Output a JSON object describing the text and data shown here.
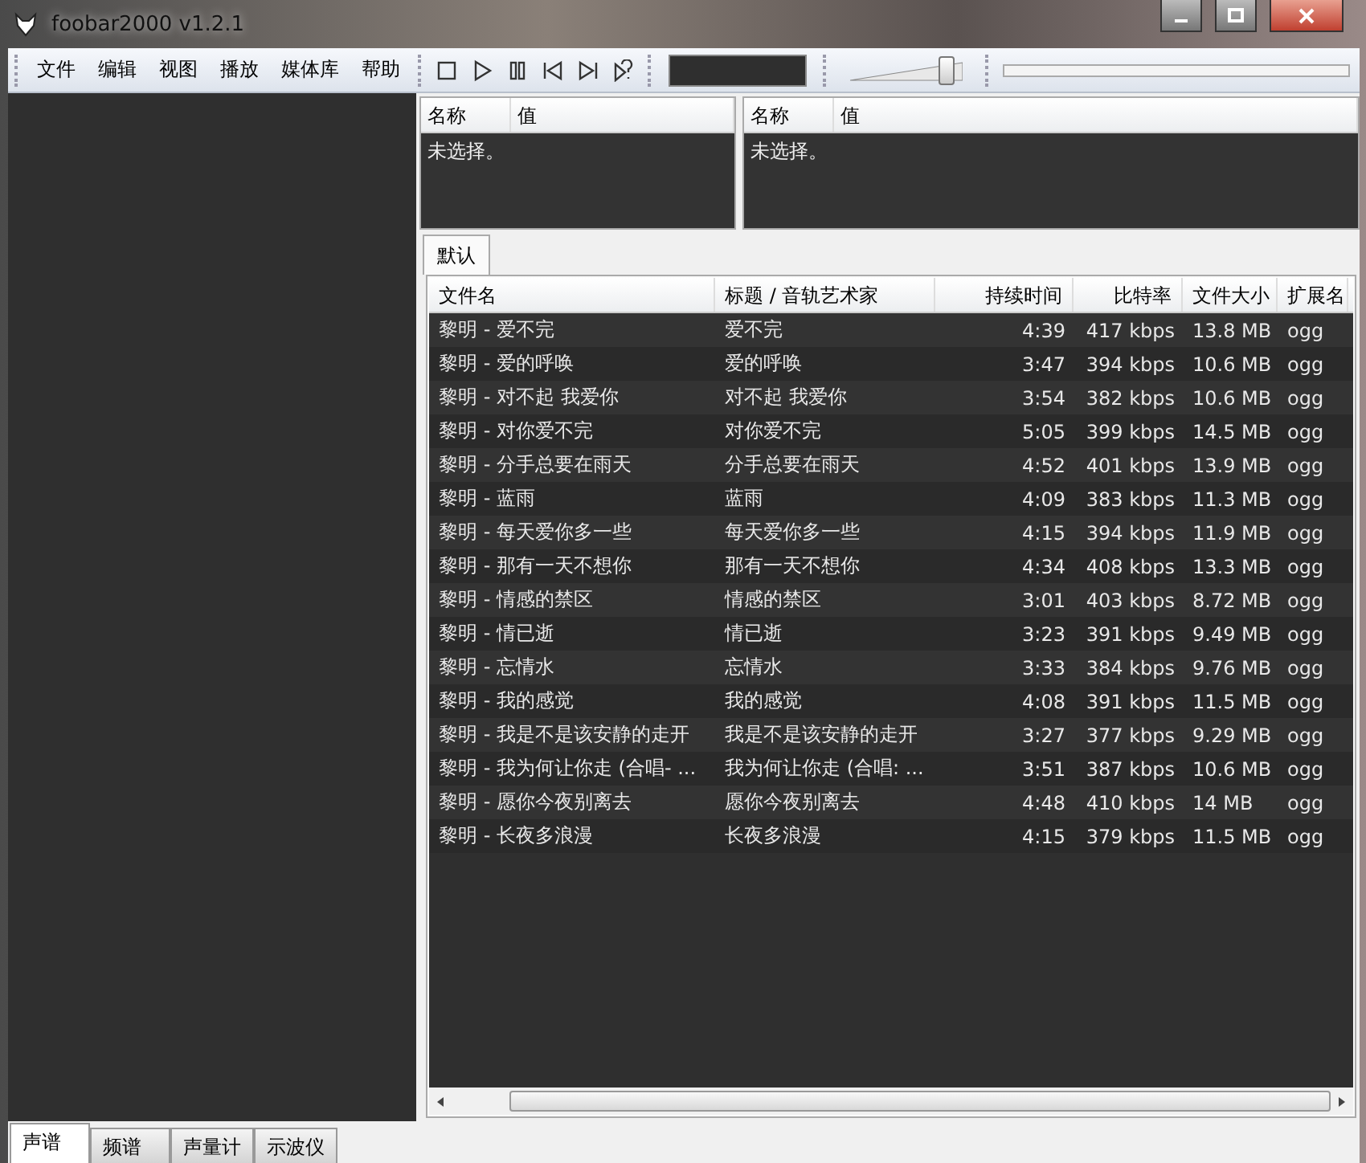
{
  "window": {
    "title": "foobar2000 v1.2.1"
  },
  "menu": [
    "文件",
    "编辑",
    "视图",
    "播放",
    "媒体库",
    "帮助"
  ],
  "volume": {
    "level": 0.86
  },
  "properties_panels": [
    {
      "columns": [
        "名称",
        "值"
      ],
      "message": "未选择。"
    },
    {
      "columns": [
        "名称",
        "值"
      ],
      "message": "未选择。"
    }
  ],
  "playlist_tabs": [
    {
      "label": "默认",
      "selected": true
    }
  ],
  "playlist": {
    "columns": [
      "文件名",
      "标题 / 音轨艺术家",
      "持续时间",
      "比特率",
      "文件大小",
      "扩展名"
    ],
    "rows": [
      [
        "黎明 - 爱不完",
        "爱不完",
        "4:39",
        "417 kbps",
        "13.8 MB",
        "ogg"
      ],
      [
        "黎明 - 爱的呼唤",
        "爱的呼唤",
        "3:47",
        "394 kbps",
        "10.6 MB",
        "ogg"
      ],
      [
        "黎明 - 对不起 我爱你",
        "对不起 我爱你",
        "3:54",
        "382 kbps",
        "10.6 MB",
        "ogg"
      ],
      [
        "黎明 - 对你爱不完",
        "对你爱不完",
        "5:05",
        "399 kbps",
        "14.5 MB",
        "ogg"
      ],
      [
        "黎明 - 分手总要在雨天",
        "分手总要在雨天",
        "4:52",
        "401 kbps",
        "13.9 MB",
        "ogg"
      ],
      [
        "黎明 - 蓝雨",
        "蓝雨",
        "4:09",
        "383 kbps",
        "11.3 MB",
        "ogg"
      ],
      [
        "黎明 - 每天爱你多一些",
        "每天爱你多一些",
        "4:15",
        "394 kbps",
        "11.9 MB",
        "ogg"
      ],
      [
        "黎明 - 那有一天不想你",
        "那有一天不想你",
        "4:34",
        "408 kbps",
        "13.3 MB",
        "ogg"
      ],
      [
        "黎明 - 情感的禁区",
        "情感的禁区",
        "3:01",
        "403 kbps",
        "8.72 MB",
        "ogg"
      ],
      [
        "黎明 - 情已逝",
        "情已逝",
        "3:23",
        "391 kbps",
        "9.49 MB",
        "ogg"
      ],
      [
        "黎明 - 忘情水",
        "忘情水",
        "3:33",
        "384 kbps",
        "9.76 MB",
        "ogg"
      ],
      [
        "黎明 - 我的感觉",
        "我的感觉",
        "4:08",
        "391 kbps",
        "11.5 MB",
        "ogg"
      ],
      [
        "黎明 - 我是不是该安静的走开",
        "我是不是该安静的走开",
        "3:27",
        "377 kbps",
        "9.29 MB",
        "ogg"
      ],
      [
        "黎明 - 我为何让你走 (合唱- ...",
        "我为何让你走 (合唱: ...",
        "3:51",
        "387 kbps",
        "10.6 MB",
        "ogg"
      ],
      [
        "黎明 - 愿你今夜别离去",
        "愿你今夜别离去",
        "4:48",
        "410 kbps",
        "14 MB",
        "ogg"
      ],
      [
        "黎明 - 长夜多浪漫",
        "长夜多浪漫",
        "4:15",
        "379 kbps",
        "11.5 MB",
        "ogg"
      ]
    ]
  },
  "visual_tabs": [
    {
      "label": "声谱",
      "selected": true
    },
    {
      "label": "频谱",
      "selected": false
    },
    {
      "label": "声量计",
      "selected": false
    },
    {
      "label": "示波仪",
      "selected": false
    }
  ]
}
